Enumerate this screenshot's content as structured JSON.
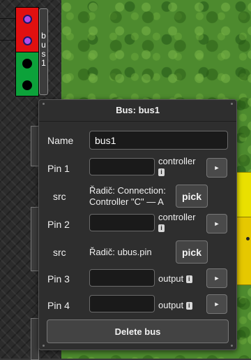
{
  "canvas": {
    "component": {
      "bus_label": "bus1"
    }
  },
  "dialog": {
    "title": "Bus: bus1",
    "name_label": "Name",
    "name_value": "bus1",
    "pins": [
      {
        "label": "Pin 1",
        "value": "",
        "type": "controller"
      },
      {
        "label": "Pin 2",
        "value": "",
        "type": "controller"
      },
      {
        "label": "Pin 3",
        "value": "",
        "type": "output"
      },
      {
        "label": "Pin 4",
        "value": "",
        "type": "output"
      }
    ],
    "src": [
      {
        "label": "src",
        "line1": "Řadič: Connection:",
        "line2": "Controller \"C\" — A",
        "pick_label": "pick"
      },
      {
        "label": "src",
        "line1": "Řadič: ubus.pin",
        "pick_label": "pick"
      }
    ],
    "info_glyph": "i",
    "arrow_glyph": "►",
    "delete_label": "Delete bus"
  },
  "icons": {
    "info": "info-icon",
    "arrow": "play-arrow-icon"
  },
  "colors": {
    "dialog_bg": "#2e2e2e",
    "red_block": "#e11010",
    "green_block": "#0ca23a",
    "pin_purple": "#b44ce6",
    "grass": "#4d8a2e",
    "yellow": "#e9e000"
  }
}
